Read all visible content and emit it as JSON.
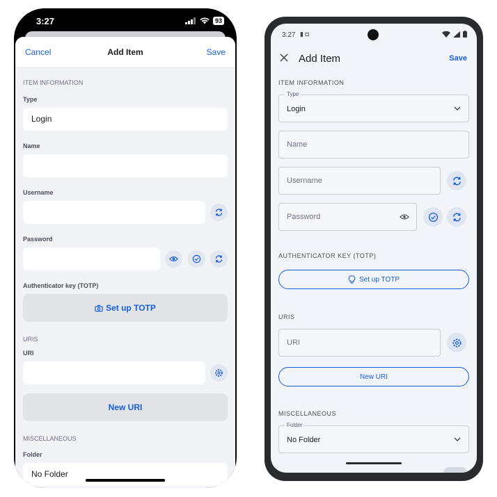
{
  "ios": {
    "status": {
      "time": "3:27",
      "battery": "93"
    },
    "nav": {
      "cancel": "Cancel",
      "title": "Add Item",
      "save": "Save"
    },
    "sections": {
      "item_information": "ITEM INFORMATION",
      "uris": "URIS",
      "miscellaneous": "MISCELLANEOUS"
    },
    "labels": {
      "type": "Type",
      "name": "Name",
      "username": "Username",
      "password": "Password",
      "totp": "Authenticator key (TOTP)",
      "uri": "URI",
      "folder": "Folder"
    },
    "values": {
      "type": "Login",
      "folder": "No Folder"
    },
    "buttons": {
      "setup_totp": "Set up TOTP",
      "new_uri": "New URI"
    }
  },
  "android": {
    "status": {
      "time": "3:27"
    },
    "appbar": {
      "title": "Add Item",
      "save": "Save"
    },
    "sections": {
      "item_information": "ITEM INFORMATION",
      "authenticator": "AUTHENTICATOR KEY (TOTP)",
      "uris": "URIS",
      "miscellaneous": "MISCELLANEOUS"
    },
    "fields": {
      "type_label": "Type",
      "type_value": "Login",
      "name_placeholder": "Name",
      "username_placeholder": "Username",
      "password_placeholder": "Password",
      "uri_placeholder": "URI",
      "folder_label": "Folder",
      "folder_value": "No Folder"
    },
    "buttons": {
      "setup_totp": "Set up TOTP",
      "new_uri": "New URI"
    }
  },
  "colors": {
    "accent": "#175ddc",
    "ios_background": "#f1f3f6",
    "android_background": "#f1f4f9"
  }
}
